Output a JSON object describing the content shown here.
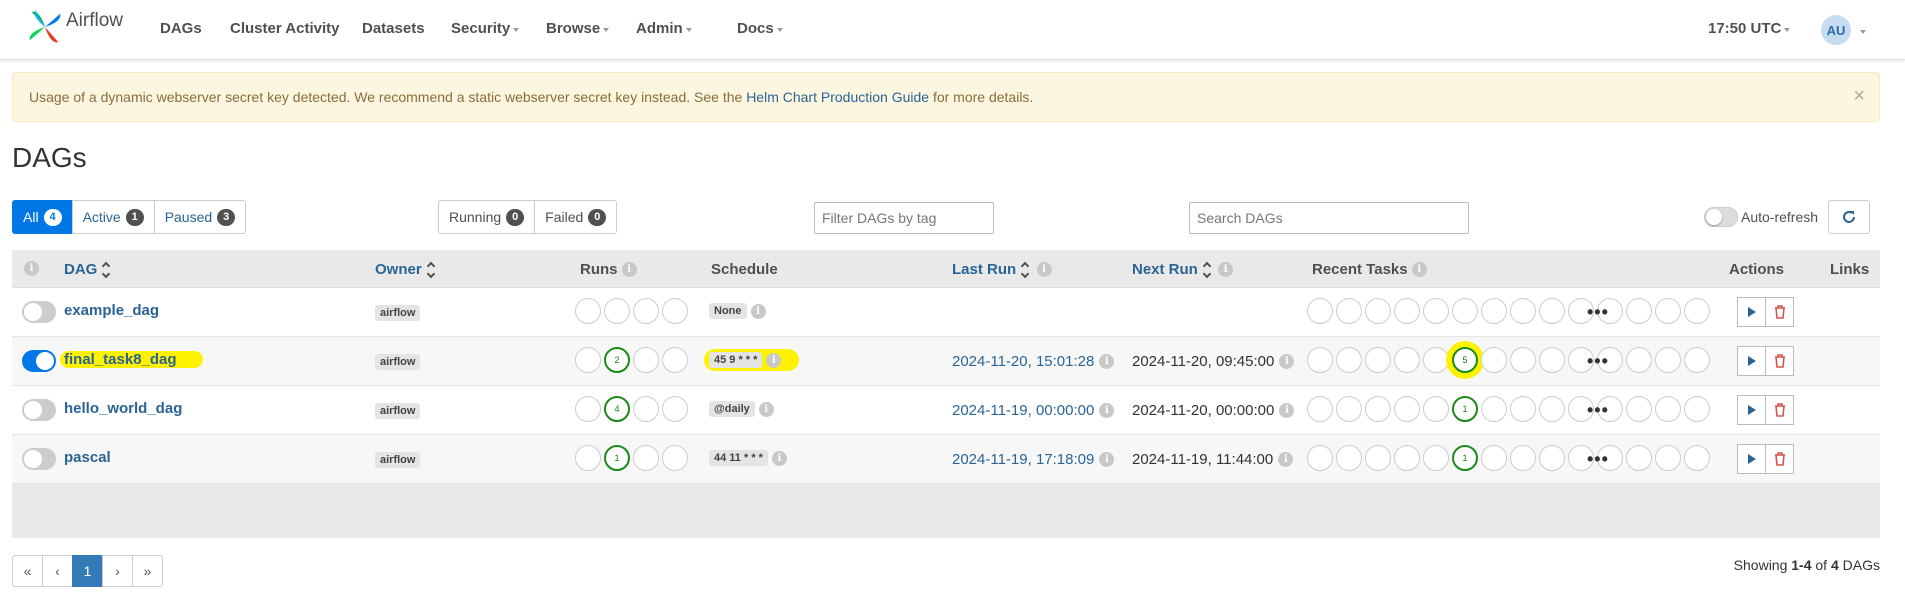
{
  "nav": {
    "brand": "Airflow",
    "items": [
      {
        "label": "DAGs",
        "dropdown": false
      },
      {
        "label": "Cluster Activity",
        "dropdown": false
      },
      {
        "label": "Datasets",
        "dropdown": false
      },
      {
        "label": "Security",
        "dropdown": true
      },
      {
        "label": "Browse",
        "dropdown": true
      },
      {
        "label": "Admin",
        "dropdown": true
      },
      {
        "label": "Docs",
        "dropdown": true
      }
    ],
    "time": "17:50 UTC",
    "user_initials": "AU"
  },
  "alert": {
    "text_before": "Usage of a dynamic webserver secret key detected. We recommend a static webserver secret key instead. See the ",
    "link": "Helm Chart Production Guide",
    "text_after": " for more details.",
    "close": "×"
  },
  "page_title": "DAGs",
  "filters": {
    "status_tabs": [
      {
        "label": "All",
        "count": "4"
      },
      {
        "label": "Active",
        "count": "1"
      },
      {
        "label": "Paused",
        "count": "3"
      }
    ],
    "state_tabs": [
      {
        "label": "Running",
        "count": "0"
      },
      {
        "label": "Failed",
        "count": "0"
      }
    ],
    "tag_placeholder": "Filter DAGs by tag",
    "search_placeholder": "Search DAGs",
    "autorefresh_label": "Auto-refresh"
  },
  "table": {
    "headers": {
      "dag": "DAG",
      "owner": "Owner",
      "runs": "Runs",
      "schedule": "Schedule",
      "last_run": "Last Run",
      "next_run": "Next Run",
      "recent_tasks": "Recent Tasks",
      "actions": "Actions",
      "links": "Links"
    },
    "rows": [
      {
        "name": "example_dag",
        "paused": true,
        "owner": "airflow",
        "runs": [
          "",
          "",
          "",
          ""
        ],
        "schedule": "None",
        "last_run": "",
        "next_run": "",
        "recent_tasks": [
          "",
          "",
          "",
          "",
          "",
          "",
          "",
          "",
          "",
          "",
          "",
          "",
          "",
          ""
        ]
      },
      {
        "name": "final_task8_dag",
        "paused": false,
        "owner": "airflow",
        "runs": [
          "",
          "2",
          "",
          ""
        ],
        "schedule": "45 9 * * *",
        "last_run": "2024-11-20, 15:01:28",
        "next_run": "2024-11-20, 09:45:00",
        "recent_tasks": [
          "",
          "",
          "",
          "",
          "",
          "5",
          "",
          "",
          "",
          "",
          "",
          "",
          "",
          ""
        ]
      },
      {
        "name": "hello_world_dag",
        "paused": true,
        "owner": "airflow",
        "runs": [
          "",
          "4",
          "",
          ""
        ],
        "schedule": "@daily",
        "last_run": "2024-11-19, 00:00:00",
        "next_run": "2024-11-20, 00:00:00",
        "recent_tasks": [
          "",
          "",
          "",
          "",
          "",
          "1",
          "",
          "",
          "",
          "",
          "",
          "",
          "",
          ""
        ]
      },
      {
        "name": "pascal",
        "paused": true,
        "owner": "airflow",
        "runs": [
          "",
          "1",
          "",
          ""
        ],
        "schedule": "44 11 * * *",
        "last_run": "2024-11-19, 17:18:09",
        "next_run": "2024-11-19, 11:44:00",
        "recent_tasks": [
          "",
          "",
          "",
          "",
          "",
          "1",
          "",
          "",
          "",
          "",
          "",
          "",
          "",
          ""
        ]
      }
    ],
    "more_links": "•••"
  },
  "pagination": {
    "first": "«",
    "prev": "‹",
    "current": "1",
    "next": "›",
    "last": "»",
    "showing_prefix": "Showing ",
    "range": "1-4",
    "of": " of ",
    "total": "4",
    "suffix": " DAGs"
  },
  "colors": {
    "accent": "#0077e6",
    "link": "#2a6496",
    "success": "#1a8a1a",
    "highlight": "#fff200",
    "alert_bg": "#fcf6e0"
  }
}
